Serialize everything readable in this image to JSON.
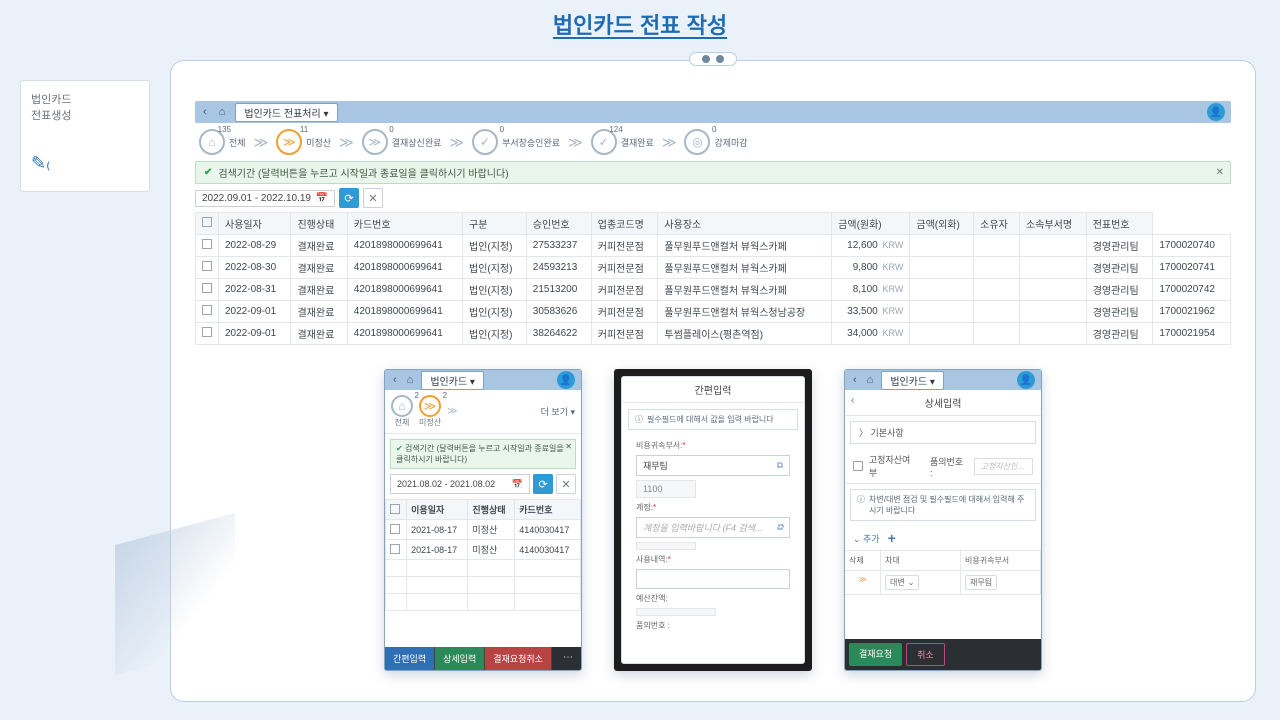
{
  "page_title": "법인카드 전표 작성",
  "side": {
    "l1": "법인카드",
    "l2": "전표생성"
  },
  "desk": {
    "dropdown": "법인카드 전표처리 ▾",
    "statuses": [
      {
        "icon": "⌂",
        "count": "135",
        "label": "전체",
        "active": false
      },
      {
        "icon": "≫",
        "count": "11",
        "label": "미정산",
        "active": true
      },
      {
        "icon": "≫",
        "count": "0",
        "label": "결재상신완료",
        "active": false
      },
      {
        "icon": "✓",
        "count": "0",
        "label": "부서장승인완료",
        "active": false
      },
      {
        "icon": "✓",
        "count": "124",
        "label": "결재완료",
        "active": false
      },
      {
        "icon": "◎",
        "count": "0",
        "label": "강제마감",
        "active": false
      }
    ],
    "info": "검색기간 (달력버튼을 누르고 시작일과 종료일을 클릭하시기 바랍니다)",
    "date_range": "2022.09.01 - 2022.10.19",
    "cols": [
      "",
      "사용일자",
      "진행상태",
      "카드번호",
      "구분",
      "승인번호",
      "업종코드명",
      "사용장소",
      "금액(원화)",
      "금액(외화)",
      "소유자",
      "소속부서명",
      "전표번호"
    ],
    "rows": [
      [
        "2022-08-29",
        "결재완료",
        "4201898000699641",
        "법인(지정)",
        "27533237",
        "커피전문점",
        "풀무원푸드앤컬처 뷰웍스카페",
        "12,600",
        "",
        "",
        "",
        "경영관리팀",
        "1700020740"
      ],
      [
        "2022-08-30",
        "결재완료",
        "4201898000699641",
        "법인(지정)",
        "24593213",
        "커피전문점",
        "풀무원푸드앤컬처 뷰웍스카페",
        "9,800",
        "",
        "",
        "",
        "경영관리팀",
        "1700020741"
      ],
      [
        "2022-08-31",
        "결재완료",
        "4201898000699641",
        "법인(지정)",
        "21513200",
        "커피전문점",
        "풀무원푸드앤컬처 뷰웍스카페",
        "8,100",
        "",
        "",
        "",
        "경영관리팀",
        "1700020742"
      ],
      [
        "2022-09-01",
        "결재완료",
        "4201898000699641",
        "법인(지정)",
        "30583626",
        "커피전문점",
        "풀무원푸드앤컬처 뷰웍스청남공장",
        "33,500",
        "",
        "",
        "",
        "경영관리팀",
        "1700021962"
      ],
      [
        "2022-09-01",
        "결재완료",
        "4201898000699641",
        "법인(지정)",
        "38264622",
        "커피전문점",
        "투썸플레이스(평촌역점)",
        "34,000",
        "",
        "",
        "",
        "경영관리팀",
        "1700021954"
      ]
    ],
    "currency": "KRW"
  },
  "m1": {
    "dropdown": "법인카드 ▾",
    "st_all": "전체",
    "st_all_n": "2",
    "st_pend": "미정산",
    "st_pend_n": "2",
    "more": "더 보기 ▾",
    "info": "검색기간 (달력버튼을 누르고 시작일과 종료일을 클릭하시기 바랍니다)",
    "date_range": "2021.08.02 - 2021.08.02",
    "cols": [
      "",
      "이용일자",
      "진행상태",
      "카드번호"
    ],
    "rows": [
      [
        "2021-08-17",
        "미정산",
        "4140030417"
      ],
      [
        "2021-08-17",
        "미정산",
        "4140030417"
      ]
    ],
    "foot": {
      "simple": "간편입력",
      "detail": "상세입력",
      "cancel": "결재요청취소"
    }
  },
  "m2": {
    "title": "간편입력",
    "hint": "필수필드에 대해서 값을 입력 바랍니다",
    "dept_label": "비용귀속부서:",
    "dept_val": "재무팀",
    "dept_code": "1100",
    "acct_label": "계정:",
    "acct_ph": "계정을 입력바랍니다 (F4 검색...",
    "desc_label": "사용내역:",
    "budget_label": "예산잔액:",
    "doc_label": "품의번호 :"
  },
  "m3": {
    "dropdown": "법인카드 ▾",
    "sub": "상세입력",
    "sec": "기본사항",
    "chk": "고정자산여부",
    "chk2_l": "품의번호 :",
    "chk2_ph": "고정자산인...",
    "hint": "차변/대변 점검 및 필수필드에 대해서 입력해 주시기 바랍니다",
    "add": "추가",
    "g_h": [
      "삭제",
      "차대",
      "비용귀속부서"
    ],
    "g_r": [
      "≫",
      "대변",
      "재무팀"
    ],
    "foot": {
      "req": "결재요청",
      "cancel": "취소"
    }
  }
}
